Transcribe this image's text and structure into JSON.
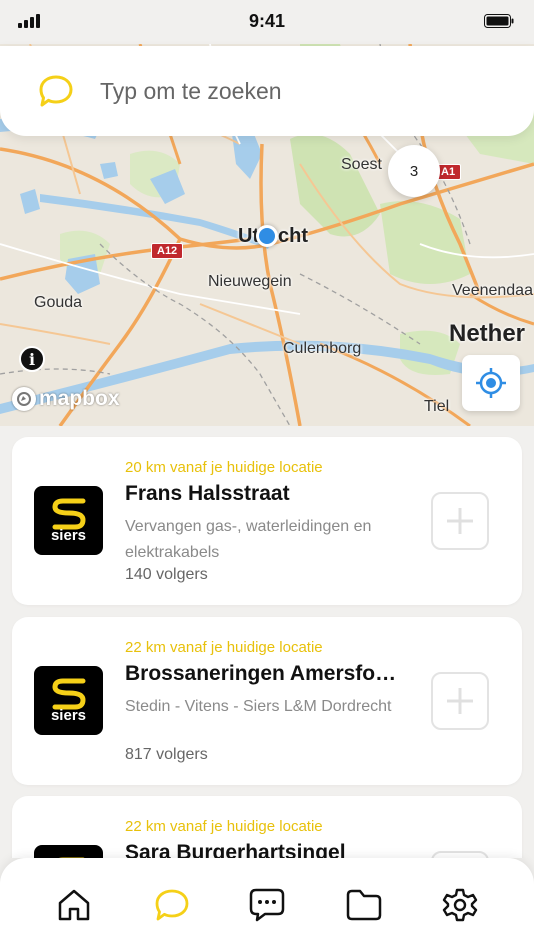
{
  "status_bar": {
    "time": "9:41"
  },
  "search": {
    "placeholder": "Typ om te zoeken"
  },
  "map": {
    "labels": {
      "soest": "Soest",
      "utrecht": "Utrecht",
      "nieuwegein": "Nieuwegein",
      "gouda": "Gouda",
      "veenendaal": "Veenendaa",
      "netherlands": "Nether",
      "culemborg": "Culemborg",
      "tiel": "Tiel"
    },
    "road_labels": {
      "a12": "A12",
      "a1": "A1"
    },
    "cluster_count": "3",
    "attribution": "mapbox"
  },
  "results": [
    {
      "distance": "20 km vanaf je huidige locatie",
      "title": "Frans Halsstraat",
      "description": "Vervangen gas-, waterleidingen en elektrakabels",
      "followers": "140 volgers",
      "logo_text": "siers"
    },
    {
      "distance": "22 km vanaf je huidige locatie",
      "title": "Brossaneringen Amersfo…",
      "description": "Stedin - Vitens - Siers L&M Dordrecht",
      "followers": "817 volgers",
      "logo_text": "siers"
    },
    {
      "distance": "22 km vanaf je huidige locatie",
      "title": "Sara Burgerhartsingel",
      "logo_text": "siers"
    }
  ],
  "tabs": [
    {
      "icon": "home-icon"
    },
    {
      "icon": "search-icon",
      "active": true
    },
    {
      "icon": "chat-icon"
    },
    {
      "icon": "folder-icon"
    },
    {
      "icon": "settings-icon"
    }
  ],
  "colors": {
    "accent": "#f5d018",
    "distance": "#e8c10c",
    "locate": "#2f8de4"
  }
}
